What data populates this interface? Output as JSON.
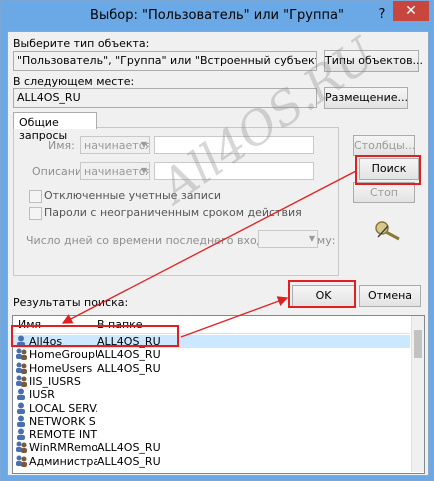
{
  "window": {
    "title": "Выбор: \"Пользователь\" или \"Группа\"",
    "help_glyph": "?",
    "close_glyph": "✕"
  },
  "object_type": {
    "label": "Выберите тип объекта:",
    "value": "\"Пользователь\", \"Группа\" или \"Встроенный субъект безопасности\"",
    "button": "Типы объектов..."
  },
  "location": {
    "label": "В следующем месте:",
    "value": "ALL4OS_RU",
    "button": "Размещение..."
  },
  "queries": {
    "tab": "Общие запросы",
    "name_label": "Имя:",
    "name_mode": "начинается с",
    "desc_label": "Описание:",
    "desc_mode": "начинается с",
    "disabled_accounts": "Отключенные учетные записи",
    "no_expire": "Пароли с неограниченным сроком действия",
    "days_label": "Число дней со времени последнего входа в систему:"
  },
  "side_buttons": {
    "columns": "Столбцы...",
    "search": "Поиск",
    "stop": "Стоп"
  },
  "results": {
    "label": "Результаты поиска:",
    "ok": "OK",
    "cancel": "Отмена",
    "col_name": "Имя",
    "col_folder": "В папке",
    "rows": [
      {
        "name": "All4os",
        "folder": "ALL4OS_RU",
        "icon": "user-icon"
      },
      {
        "name": "HomeGroupU...",
        "folder": "ALL4OS_RU",
        "icon": "group-icon"
      },
      {
        "name": "HomeUsers",
        "folder": "ALL4OS_RU",
        "icon": "group-icon"
      },
      {
        "name": "IIS_IUSRS",
        "folder": "",
        "icon": "group-icon"
      },
      {
        "name": "IUSR",
        "folder": "",
        "icon": "user-icon"
      },
      {
        "name": "LOCAL SERV...",
        "folder": "",
        "icon": "user-icon"
      },
      {
        "name": "NETWORK S...",
        "folder": "",
        "icon": "user-icon"
      },
      {
        "name": "REMOTE INT...",
        "folder": "",
        "icon": "user-icon"
      },
      {
        "name": "WinRMRemot...",
        "folder": "ALL4OS_RU",
        "icon": "group-icon"
      },
      {
        "name": "Администрат...",
        "folder": "ALL4OS_RU",
        "icon": "group-icon"
      }
    ]
  },
  "watermark": "All4OS.RU",
  "colors": {
    "highlight_red": "#e02020",
    "title_blue": "#6aa9e6",
    "selection": "#cce8ff"
  }
}
